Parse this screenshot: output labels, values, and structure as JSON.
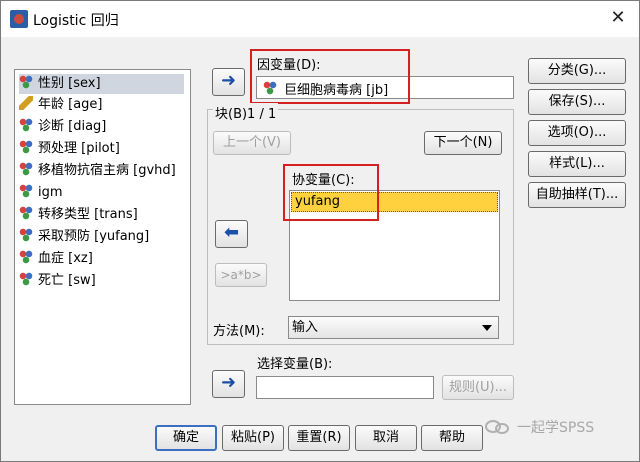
{
  "window": {
    "title": "Logistic 回归",
    "close": "✕"
  },
  "variables": [
    {
      "label": "性别 [sex]",
      "icon": "nominal-icon",
      "selected": true
    },
    {
      "label": "年龄 [age]",
      "icon": "scale-icon",
      "selected": false
    },
    {
      "label": "诊断 [diag]",
      "icon": "nominal-icon",
      "selected": false
    },
    {
      "label": "预处理 [pilot]",
      "icon": "nominal-icon",
      "selected": false
    },
    {
      "label": "移植物抗宿主病 [gvhd]",
      "icon": "nominal-icon",
      "selected": false
    },
    {
      "label": "igm",
      "icon": "nominal-icon",
      "selected": false
    },
    {
      "label": "转移类型 [trans]",
      "icon": "nominal-icon",
      "selected": false
    },
    {
      "label": "采取预防 [yufang]",
      "icon": "nominal-icon",
      "selected": false
    },
    {
      "label": "血症 [xz]",
      "icon": "nominal-icon",
      "selected": false
    },
    {
      "label": "死亡 [sw]",
      "icon": "nominal-icon",
      "selected": false
    }
  ],
  "dependent": {
    "label": "因变量(D):",
    "value": "巨细胞病毒病 [jb]"
  },
  "block": {
    "label": "块(B)1 / 1",
    "prev": "上一个(V)",
    "next": "下一个(N)"
  },
  "covariates": {
    "label": "协变量(C):",
    "items": [
      "yufang"
    ],
    "interaction": ">a*b>"
  },
  "method": {
    "label": "方法(M):",
    "value": "输入"
  },
  "selection": {
    "label": "选择变量(B):",
    "value": "",
    "rule": "规则(U)..."
  },
  "side_buttons": [
    "分类(G)...",
    "保存(S)...",
    "选项(O)...",
    "样式(L)...",
    "自助抽样(T)..."
  ],
  "bottom_buttons": [
    "确定",
    "粘贴(P)",
    "重置(R)",
    "取消",
    "帮助"
  ],
  "arrows": {
    "right": "➜",
    "left": "⬅"
  },
  "watermark": "一起学SPSS",
  "colors": {
    "highlight": "#ffd13e",
    "annotation": "#d42020",
    "arrow": "#1c4fa8"
  }
}
